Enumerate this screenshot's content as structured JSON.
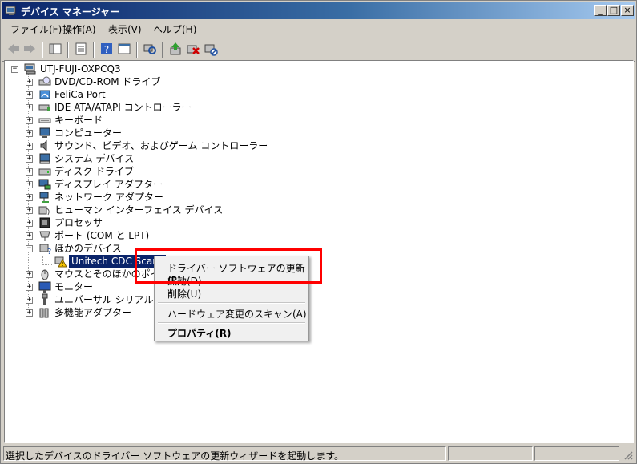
{
  "window": {
    "title": "デバイス マネージャー",
    "minimize": "_",
    "maximize": "□",
    "close": "×"
  },
  "menu": [
    "ファイル(F)",
    "操作(A)",
    "表示(V)",
    "ヘルプ(H)"
  ],
  "toolbar": [
    "back-icon",
    "forward-icon",
    "console-tree-icon",
    "properties-icon",
    "help-icon",
    "show-hide-icon",
    "scan-hardware-icon",
    "update-driver-icon",
    "uninstall-icon",
    "disable-icon"
  ],
  "tree": {
    "root": "UTJ-FUJI-OXPCQ3",
    "items": [
      {
        "label": "DVD/CD-ROM ドライブ",
        "icon": "dvd-drive-icon"
      },
      {
        "label": "FeliCa Port",
        "icon": "felica-icon"
      },
      {
        "label": "IDE ATA/ATAPI コントローラー",
        "icon": "ide-controller-icon"
      },
      {
        "label": "キーボード",
        "icon": "keyboard-icon"
      },
      {
        "label": "コンピューター",
        "icon": "computer-icon"
      },
      {
        "label": "サウンド、ビデオ、およびゲーム コントローラー",
        "icon": "sound-icon"
      },
      {
        "label": "システム デバイス",
        "icon": "system-device-icon"
      },
      {
        "label": "ディスク ドライブ",
        "icon": "disk-drive-icon"
      },
      {
        "label": "ディスプレイ アダプター",
        "icon": "display-adapter-icon"
      },
      {
        "label": "ネットワーク アダプター",
        "icon": "network-adapter-icon"
      },
      {
        "label": "ヒューマン インターフェイス デバイス",
        "icon": "hid-icon"
      },
      {
        "label": "プロセッサ",
        "icon": "processor-icon"
      },
      {
        "label": "ポート (COM と LPT)",
        "icon": "port-icon"
      },
      {
        "label": "ほかのデバイス",
        "icon": "other-devices-icon"
      },
      {
        "label": "Unitech CDC Scanner",
        "icon": "warning-device-icon"
      },
      {
        "label": "マウスとそのほかのポインティング デバイス",
        "icon": "mouse-icon"
      },
      {
        "label": "モニター",
        "icon": "monitor-icon"
      },
      {
        "label": "ユニバーサル シリアル バス コントローラー",
        "icon": "usb-icon"
      },
      {
        "label": "多機能アダプター",
        "icon": "multifunction-adapter-icon"
      }
    ]
  },
  "context_menu": {
    "update": "ドライバー ソフトウェアの更新(P)...",
    "disable": "無効(D)",
    "uninstall": "削除(U)",
    "scan": "ハードウェア変更のスキャン(A)",
    "properties": "プロパティ(R)"
  },
  "status": {
    "text": "選択したデバイスのドライバー ソフトウェアの更新ウィザードを起動します。"
  },
  "colors": {
    "titlebar_start": "#0a246a",
    "selection": "#0a246a",
    "highlight_box": "#ff0000",
    "warning": "#f7c600"
  }
}
